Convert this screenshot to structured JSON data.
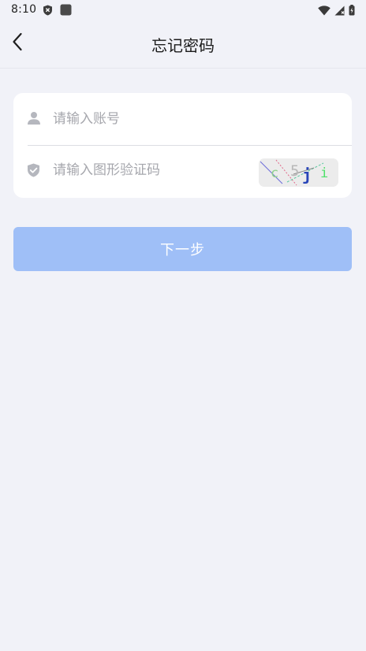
{
  "status_bar": {
    "time": "8:10",
    "left_icons": [
      "shield-x-icon",
      "app-square-icon"
    ],
    "right_icons": [
      "wifi-icon",
      "signal-icon",
      "battery-icon"
    ]
  },
  "header": {
    "title": "忘记密码",
    "back_icon": "chevron-left-icon"
  },
  "form": {
    "account": {
      "icon": "user-icon",
      "placeholder": "请输入账号",
      "value": ""
    },
    "captcha": {
      "icon": "shield-check-icon",
      "placeholder": "请输入图形验证码",
      "value": "",
      "image_text": "c5ji"
    }
  },
  "actions": {
    "next_label": "下一步"
  },
  "colors": {
    "background": "#f1f2f8",
    "card": "#ffffff",
    "primary_disabled": "#9fbff7",
    "placeholder": "#a6a7ad",
    "icon_gray": "#b5b7be"
  }
}
